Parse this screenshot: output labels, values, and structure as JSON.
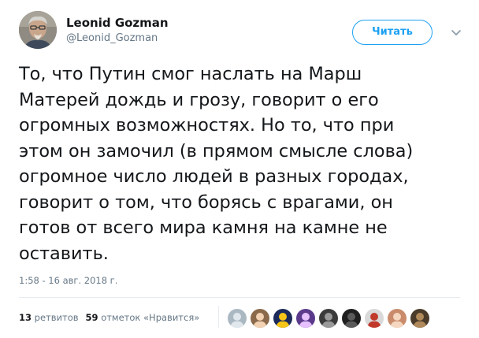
{
  "tweet": {
    "display_name": "Leonid Gozman",
    "username": "@Leonid_Gozman",
    "follow_label": "Читать",
    "text_lines": [
      "То, что Путин смог наслать на Марш",
      "Матерей дождь и грозу, говорит о его",
      "огромных возможностях. Но то, что при",
      "этом он замочил (в прямом смысле слова)",
      "огромное число людей в разных городах,",
      "говорит о том, что борясь с врагами, он",
      "готов от всего мира камня на камне не",
      "оставить."
    ],
    "timestamp": "1:58 - 16 авг. 2018 г.",
    "retweets_count": "13",
    "retweets_label": "ретвитов",
    "likes_count": "59",
    "likes_label": "отметок «Нравится»"
  },
  "icons": {
    "caret": "chevron-down-icon",
    "avatar": "user-avatar"
  },
  "colors": {
    "accent": "#1da1f2",
    "text_primary": "#14171a",
    "text_secondary": "#657786",
    "divider": "#e6ecf0"
  },
  "likers": [
    {
      "name": "liker-avatar-1",
      "bg": "#aab8c2",
      "fg": "#e1e8ed"
    },
    {
      "name": "liker-avatar-2",
      "bg": "#8a6a4a",
      "fg": "#f3d2b3"
    },
    {
      "name": "liker-avatar-3",
      "bg": "#1b2a5a",
      "fg": "#f5c518"
    },
    {
      "name": "liker-avatar-4",
      "bg": "#5b3a8c",
      "fg": "#e6c0ff"
    },
    {
      "name": "liker-avatar-5",
      "bg": "#3b3b3b",
      "fg": "#9a9a9a"
    },
    {
      "name": "liker-avatar-6",
      "bg": "#1f1f1f",
      "fg": "#5a5a5a"
    },
    {
      "name": "liker-avatar-7",
      "bg": "#d9d9d9",
      "fg": "#c0392b"
    },
    {
      "name": "liker-avatar-8",
      "bg": "#c98b6b",
      "fg": "#f5d7c0"
    },
    {
      "name": "liker-avatar-9",
      "bg": "#4a3b2a",
      "fg": "#b08a5a"
    }
  ]
}
